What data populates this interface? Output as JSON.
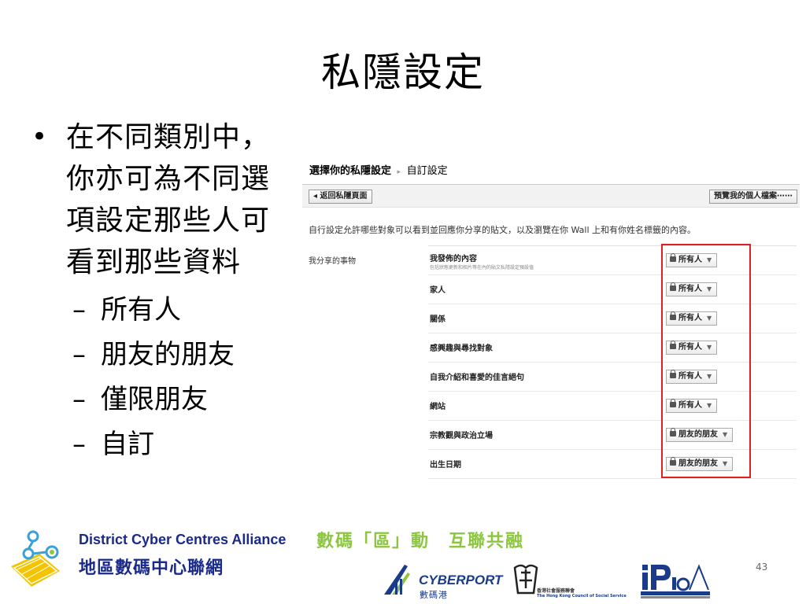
{
  "slide": {
    "title": "私隱設定",
    "bullet": "在不同類別中，你亦可為不同選項設定那些人可看到那些資料",
    "sub_items": [
      "所有人",
      "朋友的朋友",
      "僅限朋友",
      "自訂"
    ],
    "page_number": "43"
  },
  "screenshot": {
    "breadcrumb_main": "選擇你的私隱設定",
    "breadcrumb_sub": "自訂設定",
    "back_button": "返回私隱頁面",
    "preview_button": "預覽我的個人檔案⋯⋯",
    "description": "自行設定允許哪些對象可以看到並回應你分享的貼文，以及瀏覽在你 Wall 上和有你姓名標籤的內容。",
    "section_label": "我分享的事物",
    "rows": [
      {
        "label": "我發佈的內容",
        "sub": "包括狀態更新和相片等在內的貼文私隱設定預設值",
        "value": "所有人"
      },
      {
        "label": "家人",
        "value": "所有人"
      },
      {
        "label": "關係",
        "value": "所有人"
      },
      {
        "label": "感興趣與尋找對象",
        "value": "所有人"
      },
      {
        "label": "自我介紹和喜愛的佳言絕句",
        "value": "所有人"
      },
      {
        "label": "網站",
        "value": "所有人"
      },
      {
        "label": "宗教觀與政治立場",
        "value": "朋友的朋友"
      },
      {
        "label": "出生日期",
        "value": "朋友的朋友"
      }
    ],
    "highlight_color": "#e02020"
  },
  "footer": {
    "dcc_en": "District Cyber Centres Alliance",
    "dcc_zh": "地區數碼中心聯網",
    "slogan": "數碼「區」動　互聯共融",
    "cyberport_en": "CYBERPORT",
    "cyberport_zh": "數碼港",
    "ssc_zh": "香港社會服務聯會",
    "ssc_en": "The Hong Kong Council of Social Service",
    "brand_color": "#1a2a8a",
    "slogan_color": "#8cc63f"
  }
}
